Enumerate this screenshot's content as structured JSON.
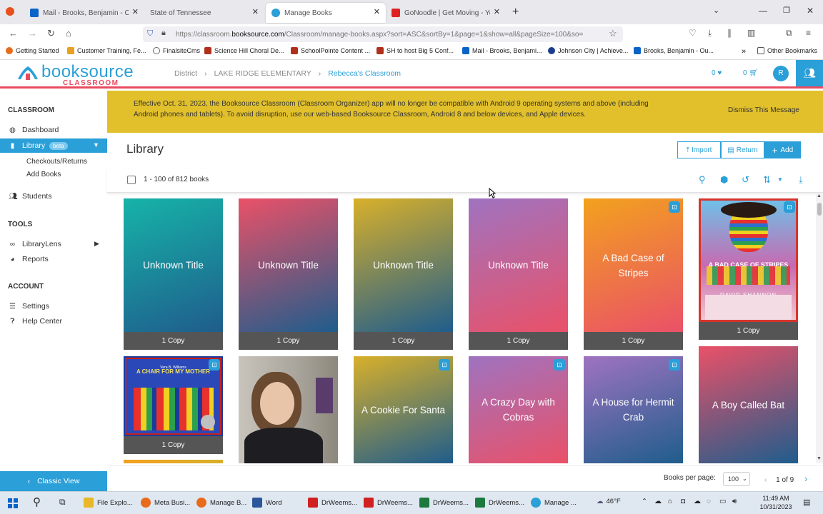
{
  "browser": {
    "tabs": [
      {
        "title": "Mail - Brooks, Benjamin - Outlo",
        "color": "#0a64c8"
      },
      {
        "title": "State of Tennessee",
        "color": "#e8e8ed"
      },
      {
        "title": "Manage Books",
        "color": "#2a9fd8"
      },
      {
        "title": "GoNoodle | Get Moving - YouTu",
        "color": "#e02020"
      }
    ],
    "url_prefix": "https://classroom.",
    "url_domain": "booksource.com",
    "url_rest": "/Classroom/manage-books.aspx?sort=ASC&sortBy=1&page=1&show=all&pageSize=100&so=",
    "bookmarks": [
      {
        "label": "Getting Started",
        "color": "#e86b1c"
      },
      {
        "label": "Customer Training, Fe...",
        "color": "#e8a020"
      },
      {
        "label": "FinalsiteCms",
        "color": "#666666"
      },
      {
        "label": "Science Hill Choral De...",
        "color": "#b0301c"
      },
      {
        "label": "SchoolPointe Content ...",
        "color": "#b0301c"
      },
      {
        "label": "SH to host Big 5 Conf...",
        "color": "#b0301c"
      },
      {
        "label": "Mail - Brooks, Benjami...",
        "color": "#0a64c8"
      },
      {
        "label": "Johnson City | Achieve...",
        "color": "#1c3c8c"
      },
      {
        "label": "Brooks, Benjamin - Ou...",
        "color": "#0a64c8"
      }
    ],
    "other_bookmarks": "Other Bookmarks"
  },
  "app": {
    "logo_main": "booksource",
    "logo_sub": "CLASSROOM",
    "breadcrumbs": [
      "District",
      "LAKE RIDGE ELEMENTARY",
      "Rebecca's Classroom"
    ],
    "favorites_count": "0",
    "cart_count": "0",
    "avatar_letter": "R"
  },
  "sidebar": {
    "classroom_header": "CLASSROOM",
    "dashboard": "Dashboard",
    "library": "Library",
    "beta": "beta",
    "checkouts": "Checkouts/Returns",
    "add_books": "Add Books",
    "students": "Students",
    "tools_header": "TOOLS",
    "librarylens": "LibraryLens",
    "reports": "Reports",
    "account_header": "ACCOUNT",
    "settings": "Settings",
    "help_center": "Help Center",
    "classic_view": "Classic View"
  },
  "banner": {
    "message": "Effective Oct. 31, 2023, the Booksource Classroom (Classroom Organizer) app will no longer be compatible with Android 9 operating systems and above (including Android phones and tablets). To avoid disruption, use our web-based Booksource Classroom, Android 8 and below devices, and Apple devices.",
    "dismiss": "Dismiss This Message"
  },
  "library": {
    "title": "Library",
    "import": "Import",
    "return": "Return",
    "add": "Add",
    "count_text": "1 - 100 of 812 books"
  },
  "books": [
    {
      "title": "Unknown Title",
      "copies": "1 Copy",
      "gradient": [
        "#16b3a8",
        "#1f5d8c"
      ],
      "badge": false
    },
    {
      "title": "Unknown Title",
      "copies": "1 Copy",
      "gradient": [
        "#ea5168",
        "#1f5d8c"
      ],
      "badge": false
    },
    {
      "title": "Unknown Title",
      "copies": "1 Copy",
      "gradient": [
        "#d8b02a",
        "#1f5d8c"
      ],
      "badge": false
    },
    {
      "title": "Unknown Title",
      "copies": "1 Copy",
      "gradient": [
        "#9f73c0",
        "#ea5168"
      ],
      "badge": false
    },
    {
      "title": "A Bad Case of Stripes",
      "copies": "1 Copy",
      "gradient": [
        "#f2a11e",
        "#ea5168"
      ],
      "badge": true
    },
    {
      "title": "A BAD CASE OF STRIPES",
      "author": "DAVID SHANNON",
      "copies": "1 Copy",
      "image": "stripes-cover",
      "badge": true
    },
    {
      "title": "A CHAIR FOR MY MOTHER",
      "author": "Vera B. Williams",
      "copies": "1 Copy",
      "image": "chair-cover",
      "badge": true
    },
    {
      "title": "",
      "copies": "",
      "image": "photo-cover",
      "badge": false
    },
    {
      "title": "A Cookie For Santa",
      "copies": "",
      "gradient": [
        "#d8b02a",
        "#1f5d8c"
      ],
      "badge": true
    },
    {
      "title": "A Crazy Day with Cobras",
      "copies": "",
      "gradient": [
        "#9f73c0",
        "#ea5168"
      ],
      "badge": true
    },
    {
      "title": "A House for Hermit Crab",
      "copies": "",
      "gradient": [
        "#9f73c0",
        "#1f5d8c"
      ],
      "badge": true
    },
    {
      "title": "A Boy Called Bat",
      "copies": "",
      "gradient": [
        "#ea5168",
        "#1f5d8c"
      ],
      "badge": false
    }
  ],
  "footer": {
    "books_per_page_label": "Books per page:",
    "books_per_page_value": "100",
    "page_text": "1 of 9"
  },
  "taskbar": {
    "items": [
      {
        "label": "File Explo...",
        "color": "#e8b828"
      },
      {
        "label": "Meta Busi...",
        "color": "#e86b1c"
      },
      {
        "label": "Manage B...",
        "color": "#e86b1c"
      },
      {
        "label": "Word",
        "color": "#2b579a"
      },
      {
        "label": "DrWeems...",
        "color": "#d02020"
      },
      {
        "label": "DrWeems...",
        "color": "#d02020"
      },
      {
        "label": "DrWeems...",
        "color": "#1d7a3e"
      },
      {
        "label": "DrWeems...",
        "color": "#1d7a3e"
      },
      {
        "label": "Manage ...",
        "color": "#2a9fd8"
      }
    ],
    "weather": "46°F",
    "time": "11:49 AM",
    "date": "10/31/2023"
  },
  "colors": {
    "accent": "#2a9fd8",
    "brand_red": "#e94b5e",
    "banner": "#e2c02b"
  }
}
